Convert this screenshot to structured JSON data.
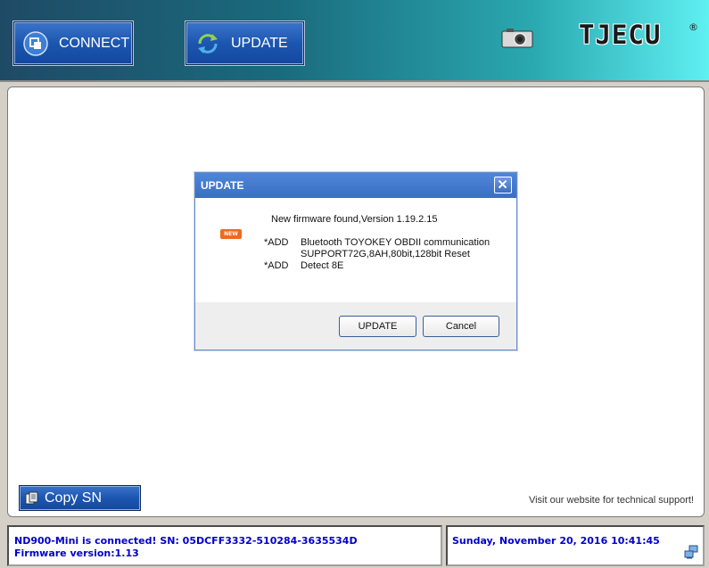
{
  "header": {
    "connect_label": "CONNECT",
    "update_label": "UPDATE",
    "logo": "TJECU",
    "logo_mark": "®"
  },
  "main": {
    "copy_sn_label": "Copy SN",
    "website_text": "Visit our website for technical support!"
  },
  "dialog": {
    "title": "UPDATE",
    "new_badge": "NEW",
    "message": "New firmware found,Version 1.19.2.15",
    "items": [
      {
        "tag": "*ADD",
        "lines": [
          "Bluetooth TOYOKEY OBDII communication",
          "SUPPORT72G,8AH,80bit,128bit Reset"
        ]
      },
      {
        "tag": "*ADD",
        "lines": [
          "Detect 8E"
        ]
      }
    ],
    "update_button": "UPDATE",
    "cancel_button": "Cancel"
  },
  "status": {
    "connection": "ND900-Mini is connected! SN: 05DCFF3332-510284-3635534D",
    "firmware": "Firmware version:1.13",
    "datetime": "Sunday, November 20, 2016  10:41:45"
  },
  "colors": {
    "status_text": "#0000cc",
    "button_blue": "#1c56b0",
    "header_start": "#1f4a66",
    "header_end": "#5ff0f2"
  },
  "icons": [
    "connect-icon",
    "update-refresh-icon",
    "camera-icon",
    "copy-icon",
    "close-icon",
    "network-icon"
  ]
}
